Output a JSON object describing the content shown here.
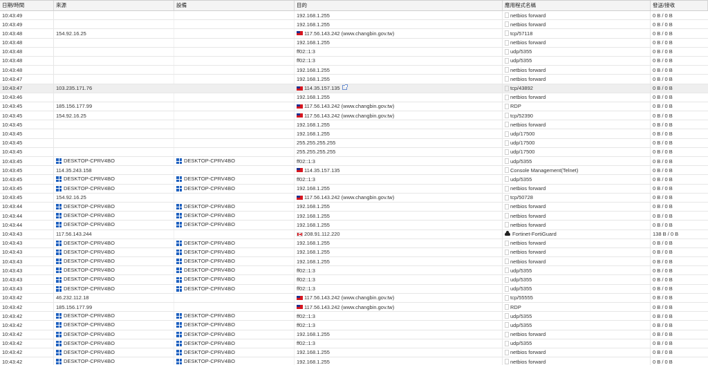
{
  "headers": {
    "time": "日期/時間",
    "source": "來源",
    "device": "設備",
    "destination": "目的",
    "application": "應用程式名稱",
    "bytes": "發送/接收"
  },
  "rows": [
    {
      "time": "10:43:49",
      "source": "",
      "device": "",
      "destination": "192.168.1.255",
      "dest_flag": "",
      "application": "netbios forward",
      "app_icon": "box",
      "bytes": "0 B / 0 B"
    },
    {
      "time": "10:43:49",
      "source": "",
      "device": "",
      "destination": "192.168.1.255",
      "dest_flag": "",
      "application": "netbios forward",
      "app_icon": "box",
      "bytes": "0 B / 0 B"
    },
    {
      "time": "10:43:48",
      "source": "154.92.16.25",
      "device": "",
      "destination": "117.56.143.242 (www.changbin.gov.tw)",
      "dest_flag": "tw",
      "application": "tcp/57118",
      "app_icon": "box",
      "bytes": "0 B / 0 B"
    },
    {
      "time": "10:43:48",
      "source": "",
      "device": "",
      "destination": "192.168.1.255",
      "dest_flag": "",
      "application": "netbios forward",
      "app_icon": "box",
      "bytes": "0 B / 0 B"
    },
    {
      "time": "10:43:48",
      "source": "",
      "device": "",
      "destination": "ff02::1:3",
      "dest_flag": "",
      "application": "udp/5355",
      "app_icon": "box",
      "bytes": "0 B / 0 B"
    },
    {
      "time": "10:43:48",
      "source": "",
      "device": "",
      "destination": "ff02::1:3",
      "dest_flag": "",
      "application": "udp/5355",
      "app_icon": "box",
      "bytes": "0 B / 0 B"
    },
    {
      "time": "10:43:48",
      "source": "",
      "device": "",
      "destination": "192.168.1.255",
      "dest_flag": "",
      "application": "netbios forward",
      "app_icon": "box",
      "bytes": "0 B / 0 B"
    },
    {
      "time": "10:43:47",
      "source": "",
      "device": "",
      "destination": "192.168.1.255",
      "dest_flag": "",
      "application": "netbios forward",
      "app_icon": "box",
      "bytes": "0 B / 0 B"
    },
    {
      "time": "10:43:47",
      "source": "103.235.171.76",
      "device": "",
      "destination": "114.35.157.135",
      "dest_flag": "tw",
      "dest_ext": true,
      "application": "tcp/43892",
      "app_icon": "box",
      "bytes": "0 B / 0 B",
      "highlight": true
    },
    {
      "time": "10:43:46",
      "source": "",
      "device": "",
      "destination": "192.168.1.255",
      "dest_flag": "",
      "application": "netbios forward",
      "app_icon": "box",
      "bytes": "0 B / 0 B"
    },
    {
      "time": "10:43:45",
      "source": "185.156.177.99",
      "device": "",
      "destination": "117.56.143.242 (www.changbin.gov.tw)",
      "dest_flag": "tw",
      "application": "RDP",
      "app_icon": "box",
      "bytes": "0 B / 0 B"
    },
    {
      "time": "10:43:45",
      "source": "154.92.16.25",
      "device": "",
      "destination": "117.56.143.242 (www.changbin.gov.tw)",
      "dest_flag": "tw",
      "application": "tcp/52390",
      "app_icon": "box",
      "bytes": "0 B / 0 B"
    },
    {
      "time": "10:43:45",
      "source": "",
      "device": "",
      "destination": "192.168.1.255",
      "dest_flag": "",
      "application": "netbios forward",
      "app_icon": "box",
      "bytes": "0 B / 0 B"
    },
    {
      "time": "10:43:45",
      "source": "",
      "device": "",
      "destination": "192.168.1.255",
      "dest_flag": "",
      "application": "udp/17500",
      "app_icon": "box",
      "bytes": "0 B / 0 B"
    },
    {
      "time": "10:43:45",
      "source": "",
      "device": "",
      "destination": "255.255.255.255",
      "dest_flag": "",
      "application": "udp/17500",
      "app_icon": "box",
      "bytes": "0 B / 0 B"
    },
    {
      "time": "10:43:45",
      "source": "",
      "device": "",
      "destination": "255.255.255.255",
      "dest_flag": "",
      "application": "udp/17500",
      "app_icon": "box",
      "bytes": "0 B / 0 B"
    },
    {
      "time": "10:43:45",
      "source": "DESKTOP-CPRV4BO",
      "source_win": true,
      "device": "DESKTOP-CPRV4BO",
      "device_win": true,
      "destination": "ff02::1:3",
      "dest_flag": "",
      "application": "udp/5355",
      "app_icon": "box",
      "bytes": "0 B / 0 B"
    },
    {
      "time": "10:43:45",
      "source": "114.35.243.158",
      "device": "",
      "destination": "114.35.157.135",
      "dest_flag": "tw",
      "application": "Console Management(Telnet)",
      "app_icon": "box",
      "bytes": "0 B / 0 B"
    },
    {
      "time": "10:43:45",
      "source": "DESKTOP-CPRV4BO",
      "source_win": true,
      "device": "DESKTOP-CPRV4BO",
      "device_win": true,
      "destination": "ff02::1:3",
      "dest_flag": "",
      "application": "udp/5355",
      "app_icon": "box",
      "bytes": "0 B / 0 B"
    },
    {
      "time": "10:43:45",
      "source": "DESKTOP-CPRV4BO",
      "source_win": true,
      "device": "DESKTOP-CPRV4BO",
      "device_win": true,
      "destination": "192.168.1.255",
      "dest_flag": "",
      "application": "netbios forward",
      "app_icon": "box",
      "bytes": "0 B / 0 B"
    },
    {
      "time": "10:43:45",
      "source": "154.92.16.25",
      "device": "",
      "destination": "117.56.143.242 (www.changbin.gov.tw)",
      "dest_flag": "tw",
      "application": "tcp/50728",
      "app_icon": "box",
      "bytes": "0 B / 0 B"
    },
    {
      "time": "10:43:44",
      "source": "DESKTOP-CPRV4BO",
      "source_win": true,
      "device": "DESKTOP-CPRV4BO",
      "device_win": true,
      "destination": "192.168.1.255",
      "dest_flag": "",
      "application": "netbios forward",
      "app_icon": "box",
      "bytes": "0 B / 0 B"
    },
    {
      "time": "10:43:44",
      "source": "DESKTOP-CPRV4BO",
      "source_win": true,
      "device": "DESKTOP-CPRV4BO",
      "device_win": true,
      "destination": "192.168.1.255",
      "dest_flag": "",
      "application": "netbios forward",
      "app_icon": "box",
      "bytes": "0 B / 0 B"
    },
    {
      "time": "10:43:44",
      "source": "DESKTOP-CPRV4BO",
      "source_win": true,
      "device": "DESKTOP-CPRV4BO",
      "device_win": true,
      "destination": "192.168.1.255",
      "dest_flag": "",
      "application": "netbios forward",
      "app_icon": "box",
      "bytes": "0 B / 0 B"
    },
    {
      "time": "10:43:43",
      "source": "117.56.143.244",
      "device": "",
      "destination": "208.91.112.220",
      "dest_flag": "ca",
      "application": "Fortinet-FortiGuard",
      "app_icon": "cloud",
      "bytes": "138 B / 0 B"
    },
    {
      "time": "10:43:43",
      "source": "DESKTOP-CPRV4BO",
      "source_win": true,
      "device": "DESKTOP-CPRV4BO",
      "device_win": true,
      "destination": "192.168.1.255",
      "dest_flag": "",
      "application": "netbios forward",
      "app_icon": "box",
      "bytes": "0 B / 0 B"
    },
    {
      "time": "10:43:43",
      "source": "DESKTOP-CPRV4BO",
      "source_win": true,
      "device": "DESKTOP-CPRV4BO",
      "device_win": true,
      "destination": "192.168.1.255",
      "dest_flag": "",
      "application": "netbios forward",
      "app_icon": "box",
      "bytes": "0 B / 0 B"
    },
    {
      "time": "10:43:43",
      "source": "DESKTOP-CPRV4BO",
      "source_win": true,
      "device": "DESKTOP-CPRV4BO",
      "device_win": true,
      "destination": "192.168.1.255",
      "dest_flag": "",
      "application": "netbios forward",
      "app_icon": "box",
      "bytes": "0 B / 0 B"
    },
    {
      "time": "10:43:43",
      "source": "DESKTOP-CPRV4BO",
      "source_win": true,
      "device": "DESKTOP-CPRV4BO",
      "device_win": true,
      "destination": "ff02::1:3",
      "dest_flag": "",
      "application": "udp/5355",
      "app_icon": "box",
      "bytes": "0 B / 0 B"
    },
    {
      "time": "10:43:43",
      "source": "DESKTOP-CPRV4BO",
      "source_win": true,
      "device": "DESKTOP-CPRV4BO",
      "device_win": true,
      "destination": "ff02::1:3",
      "dest_flag": "",
      "application": "udp/5355",
      "app_icon": "box",
      "bytes": "0 B / 0 B"
    },
    {
      "time": "10:43:43",
      "source": "DESKTOP-CPRV4BO",
      "source_win": true,
      "device": "DESKTOP-CPRV4BO",
      "device_win": true,
      "destination": "ff02::1:3",
      "dest_flag": "",
      "application": "udp/5355",
      "app_icon": "box",
      "bytes": "0 B / 0 B"
    },
    {
      "time": "10:43:42",
      "source": "46.232.112.18",
      "device": "",
      "destination": "117.56.143.242 (www.changbin.gov.tw)",
      "dest_flag": "tw",
      "application": "tcp/55555",
      "app_icon": "box",
      "bytes": "0 B / 0 B"
    },
    {
      "time": "10:43:42",
      "source": "185.156.177.99",
      "device": "",
      "destination": "117.56.143.242 (www.changbin.gov.tw)",
      "dest_flag": "tw",
      "application": "RDP",
      "app_icon": "box",
      "bytes": "0 B / 0 B"
    },
    {
      "time": "10:43:42",
      "source": "DESKTOP-CPRV4BO",
      "source_win": true,
      "device": "DESKTOP-CPRV4BO",
      "device_win": true,
      "destination": "ff02::1:3",
      "dest_flag": "",
      "application": "udp/5355",
      "app_icon": "box",
      "bytes": "0 B / 0 B"
    },
    {
      "time": "10:43:42",
      "source": "DESKTOP-CPRV4BO",
      "source_win": true,
      "device": "DESKTOP-CPRV4BO",
      "device_win": true,
      "destination": "ff02::1:3",
      "dest_flag": "",
      "application": "udp/5355",
      "app_icon": "box",
      "bytes": "0 B / 0 B"
    },
    {
      "time": "10:43:42",
      "source": "DESKTOP-CPRV4BO",
      "source_win": true,
      "device": "DESKTOP-CPRV4BO",
      "device_win": true,
      "destination": "192.168.1.255",
      "dest_flag": "",
      "application": "netbios forward",
      "app_icon": "box",
      "bytes": "0 B / 0 B"
    },
    {
      "time": "10:43:42",
      "source": "DESKTOP-CPRV4BO",
      "source_win": true,
      "device": "DESKTOP-CPRV4BO",
      "device_win": true,
      "destination": "ff02::1:3",
      "dest_flag": "",
      "application": "udp/5355",
      "app_icon": "box",
      "bytes": "0 B / 0 B"
    },
    {
      "time": "10:43:42",
      "source": "DESKTOP-CPRV4BO",
      "source_win": true,
      "device": "DESKTOP-CPRV4BO",
      "device_win": true,
      "destination": "192.168.1.255",
      "dest_flag": "",
      "application": "netbios forward",
      "app_icon": "box",
      "bytes": "0 B / 0 B"
    },
    {
      "time": "10:43:42",
      "source": "DESKTOP-CPRV4BO",
      "source_win": true,
      "device": "DESKTOP-CPRV4BO",
      "device_win": true,
      "destination": "192.168.1.255",
      "dest_flag": "",
      "application": "netbios forward",
      "app_icon": "box",
      "bytes": "0 B / 0 B"
    }
  ]
}
